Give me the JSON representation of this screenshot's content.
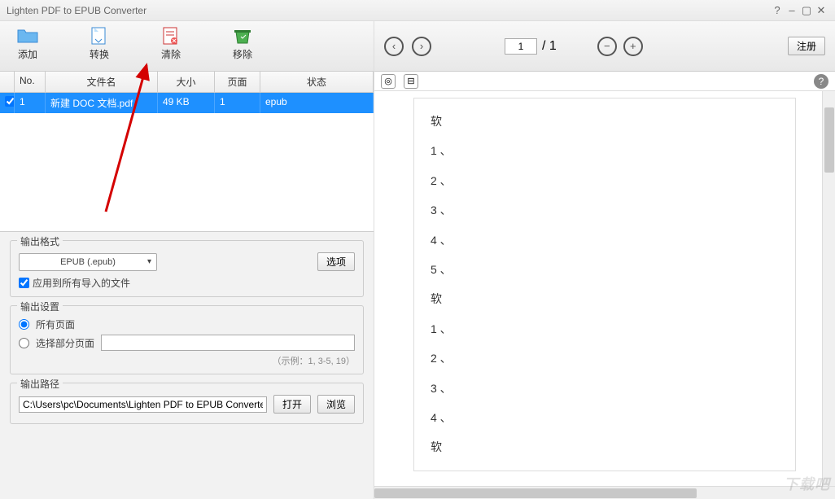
{
  "window": {
    "title": "Lighten PDF to EPUB Converter"
  },
  "toolbar": {
    "add": "添加",
    "convert": "转换",
    "clear": "清除",
    "remove": "移除"
  },
  "table": {
    "headers": {
      "no": "No.",
      "name": "文件名",
      "size": "大小",
      "page": "页面",
      "status": "状态"
    },
    "rows": [
      {
        "no": "1",
        "name": "新建 DOC 文档.pdf",
        "size": "49 KB",
        "page": "1",
        "status": "epub"
      }
    ]
  },
  "format": {
    "legend": "输出格式",
    "value": "EPUB (.epub)",
    "options_label": "选项",
    "apply_all": "应用到所有导入的文件"
  },
  "pagesetting": {
    "legend": "输出设置",
    "all_pages": "所有页面",
    "select_pages": "选择部分页面",
    "hint": "（示例：1, 3-5, 19）"
  },
  "outpath": {
    "legend": "输出路径",
    "value": "C:\\Users\\pc\\Documents\\Lighten PDF to EPUB Converter",
    "open": "打开",
    "browse": "浏览"
  },
  "nav": {
    "page": "1",
    "total": "/  1",
    "register": "注册"
  },
  "preview": {
    "lines": [
      "软",
      "1 、",
      "2 、",
      "3 、",
      "4 、",
      "5 、",
      "软",
      "1 、",
      "2 、",
      "3 、",
      "4 、",
      "软"
    ]
  },
  "watermark": "下载吧"
}
